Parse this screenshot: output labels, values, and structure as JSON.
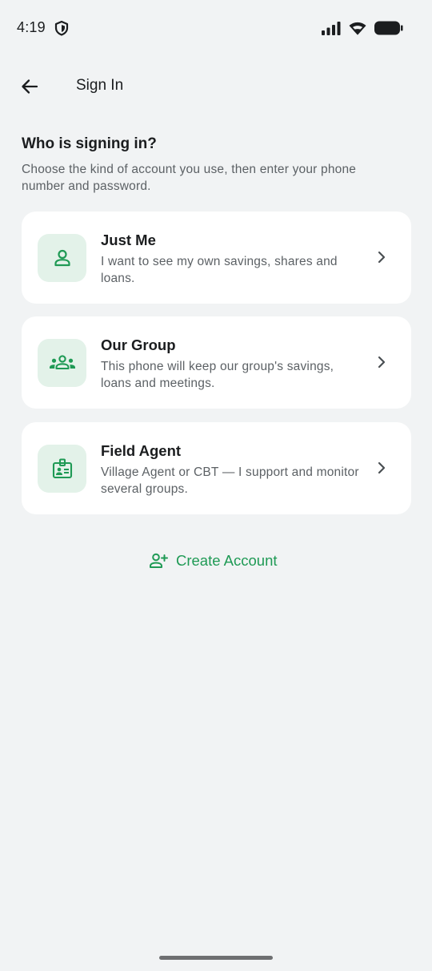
{
  "status_bar": {
    "time": "4:19",
    "icons": [
      "shield-icon",
      "signal-icon",
      "wifi-icon",
      "battery-icon"
    ]
  },
  "app_bar": {
    "back_icon": "arrow-left-icon",
    "title": "Sign In"
  },
  "main": {
    "heading": "Who is signing in?",
    "subheading": "Choose the kind of account you use, then enter your phone number and password.",
    "options": [
      {
        "icon": "person-icon",
        "title": "Just Me",
        "description": "I want to see my own savings, shares and loans."
      },
      {
        "icon": "group-icon",
        "title": "Our Group",
        "description": "This phone will keep our group's savings, loans and meetings."
      },
      {
        "icon": "id-badge-icon",
        "title": "Field Agent",
        "description": "Village Agent or CBT — I support and monitor several groups."
      }
    ],
    "create_account": {
      "icon": "person-add-icon",
      "label": "Create Account"
    }
  },
  "colors": {
    "background": "#f1f3f4",
    "card": "#ffffff",
    "accent": "#1f9a55",
    "icon_tint": "#e3f2e9",
    "text_primary": "#1b1d1f",
    "text_secondary": "#5c6165"
  }
}
